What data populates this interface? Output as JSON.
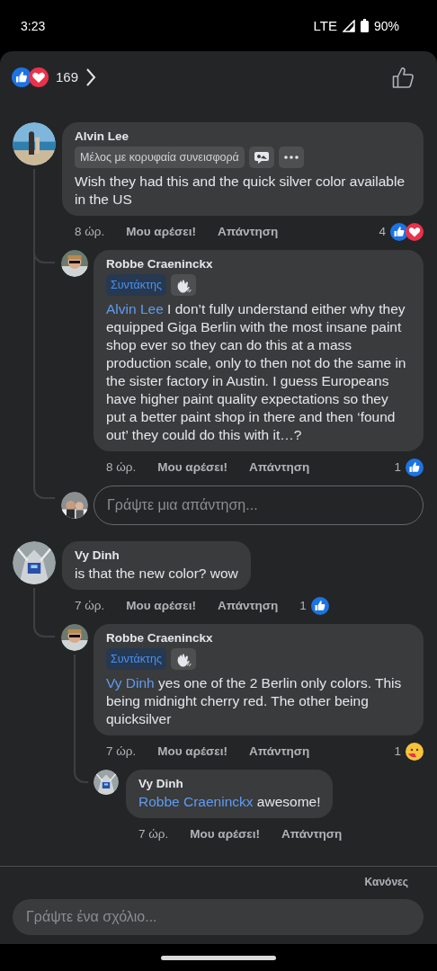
{
  "status_bar": {
    "time": "3:23",
    "network": "LTE",
    "battery": "90%"
  },
  "header": {
    "reactions": [
      {
        "kind": "like"
      },
      {
        "kind": "love"
      }
    ],
    "count": "169"
  },
  "comments": [
    {
      "author": "Alvin Lee",
      "badges": [
        {
          "kind": "label",
          "label": "Μέλος με κορυφαία συνεισφορά"
        },
        {
          "kind": "chat"
        },
        {
          "kind": "more"
        }
      ],
      "text": "Wish they had this and the quick silver color available in the US",
      "time": "8 ώρ.",
      "like": "Μου αρέσει!",
      "reply": "Απάντηση",
      "reaction_count": "4",
      "reactions": [
        {
          "kind": "like"
        },
        {
          "kind": "love"
        }
      ],
      "children": [
        {
          "author": "Robbe Craeninckx",
          "badges": [
            {
              "kind": "role",
              "label": "Συντάκτης"
            },
            {
              "kind": "wave"
            }
          ],
          "mention": "Alvin Lee",
          "text": "I don’t fully understand either why they equipped Giga Berlin with the most insane paint shop ever so they can do this at a mass production scale, only to then not do the same in the sister factory in Austin. I guess Europeans have higher paint quality expectations so they put a better paint shop in there and then ‘found out’ they could do this with it…?",
          "time": "8 ώρ.",
          "like": "Μου αρέσει!",
          "reply": "Απάντηση",
          "reaction_count": "1",
          "reactions": [
            {
              "kind": "like"
            }
          ]
        }
      ],
      "reply_field": {
        "placeholder": "Γράψτε μια απάντηση..."
      }
    },
    {
      "author": "Vy Dinh",
      "text": "is that the new color? wow",
      "time": "7 ώρ.",
      "like": "Μου αρέσει!",
      "reply": "Απάντηση",
      "reaction_count": "1",
      "reactions": [
        {
          "kind": "like"
        }
      ],
      "children": [
        {
          "author": "Robbe Craeninckx",
          "badges": [
            {
              "kind": "role",
              "label": "Συντάκτης"
            },
            {
              "kind": "wave"
            }
          ],
          "mention": "Vy Dinh",
          "text": "yes one of the 2 Berlin only colors. This being midnight cherry red. The other being quicksilver",
          "time": "7 ώρ.",
          "like": "Μου αρέσει!",
          "reply": "Απάντηση",
          "reaction_count": "1",
          "reactions": [
            {
              "kind": "care"
            }
          ],
          "children": [
            {
              "author": "Vy Dinh",
              "mention": "Robbe Craeninckx",
              "text": "awesome!",
              "time": "7 ώρ.",
              "like": "Μου αρέσει!",
              "reply": "Απάντηση"
            }
          ]
        }
      ]
    }
  ],
  "footer": {
    "rules": "Κανόνες",
    "placeholder": "Γράψτε ένα σχόλιο..."
  }
}
